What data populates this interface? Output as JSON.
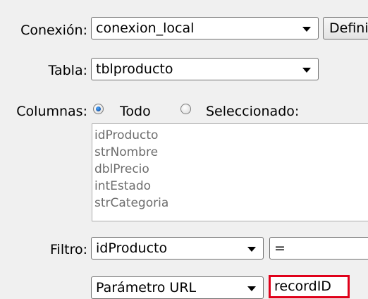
{
  "connection": {
    "label": "Conexión:",
    "selected": "conexion_local",
    "define_button": "Definir..."
  },
  "table": {
    "label": "Tabla:",
    "selected": "tblproducto"
  },
  "columns": {
    "label": "Columnas:",
    "options": [
      "Todo",
      "Seleccionado:"
    ],
    "selected_option": "Todo",
    "items": [
      "idProducto",
      "strNombre",
      "dblPrecio",
      "intEstado",
      "strCategoria"
    ]
  },
  "filter": {
    "label": "Filtro:",
    "column": "idProducto",
    "operator": "=",
    "source": "Parámetro URL",
    "value": "recordID"
  },
  "colors": {
    "highlight_border": "#e0001a",
    "radio_selected": "#0a3b8a"
  }
}
